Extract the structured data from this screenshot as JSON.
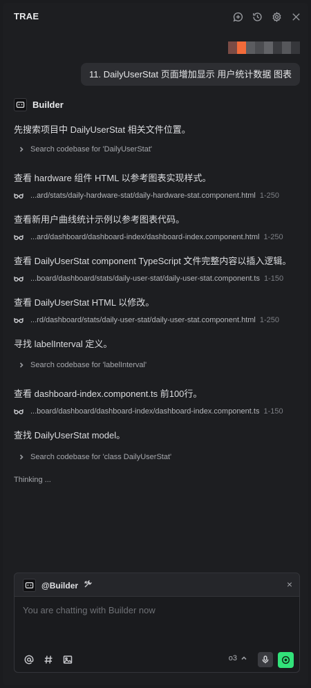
{
  "app": {
    "title": "TRAE"
  },
  "header": {
    "icons": [
      "new-chat-icon",
      "history-icon",
      "settings-icon",
      "close-icon"
    ]
  },
  "user_message": {
    "text": "11. DailyUserStat 页面增加显示 用户统计数据 图表",
    "avatar_colors": [
      "#7a4b45",
      "#f26b3a",
      "#5b5c60",
      "#4b4c50",
      "#626367",
      "#3a3b3f",
      "#56575b",
      "#36373b"
    ]
  },
  "builder": {
    "name": "Builder"
  },
  "steps": [
    {
      "text": "先搜索项目中 DailyUserStat 相关文件位置。",
      "kind": "search",
      "detail": "Search codebase for 'DailyUserStat'"
    },
    {
      "text": "查看 hardware 组件 HTML 以参考图表实现样式。",
      "kind": "view",
      "path": "...ard/stats/daily-hardware-stat/daily-hardware-stat.component.html",
      "range": "1-250"
    },
    {
      "text": "查看新用户曲线统计示例以参考图表代码。",
      "kind": "view",
      "path": "...ard/dashboard/dashboard-index/dashboard-index.component.html",
      "range": "1-250"
    },
    {
      "text": "查看 DailyUserStat component TypeScript 文件完整内容以插入逻辑。",
      "kind": "view",
      "path": "...board/dashboard/stats/daily-user-stat/daily-user-stat.component.ts",
      "range": "1-150"
    },
    {
      "text": "查看 DailyUserStat HTML 以修改。",
      "kind": "view",
      "path": "...rd/dashboard/stats/daily-user-stat/daily-user-stat.component.html",
      "range": "1-250"
    },
    {
      "text": "寻找 labelInterval 定义。",
      "kind": "search",
      "detail": "Search codebase for 'labelInterval'"
    },
    {
      "text": "查看 dashboard-index.component.ts 前100行。",
      "kind": "view",
      "path": "...board/dashboard/dashboard-index/dashboard-index.component.ts",
      "range": "1-150"
    },
    {
      "text": "查找 DailyUserStat model。",
      "kind": "search",
      "detail": "Search codebase for 'class DailyUserStat'"
    }
  ],
  "status": {
    "thinking": "Thinking ..."
  },
  "composer": {
    "agent_tag": "@Builder",
    "close_label": "×",
    "placeholder": "You are chatting with Builder now",
    "value": "",
    "model": "o3",
    "accent": "#32e27a"
  }
}
